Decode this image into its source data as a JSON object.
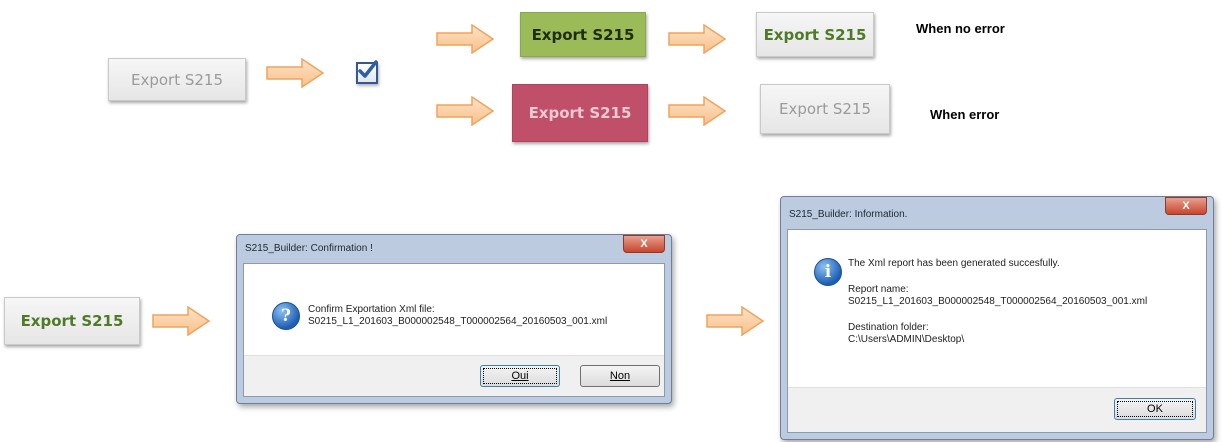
{
  "row_top": {
    "start_button": "Export S215",
    "success_button": "Export S215",
    "error_button": "Export S215",
    "result_success_button": "Export S215",
    "result_error_button": "Export S215",
    "note_success": "When no error",
    "note_error": "When error"
  },
  "row_bottom": {
    "start_button": "Export S215",
    "confirm_dialog": {
      "title": "S215_Builder: Confirmation !",
      "close": "X",
      "message_line1": "Confirm Exportation Xml file:",
      "message_line2": "S0215_L1_201603_B000002548_T000002564_20160503_001.xml",
      "yes_label": "Oui",
      "no_label": "Non",
      "icon": "question-icon"
    },
    "info_dialog": {
      "title": "S215_Builder: Information.",
      "close": "X",
      "message": "The Xml report has been  generated succesfully.",
      "report_label": "Report name:",
      "report_value": "S0215_L1_201603_B000002548_T000002564_20160503_001.xml",
      "folder_label": "Destination folder:",
      "folder_value": "C:\\Users\\ADMIN\\Desktop\\",
      "ok_label": "OK",
      "icon": "info-icon"
    }
  },
  "colors": {
    "arrow_fill": "#fbd0a3",
    "arrow_stroke": "#f0a35c",
    "checkbox_border": "#35598c",
    "check_mark": "#2f5f9e",
    "green": "#9bbb59",
    "red": "#c0506a"
  }
}
